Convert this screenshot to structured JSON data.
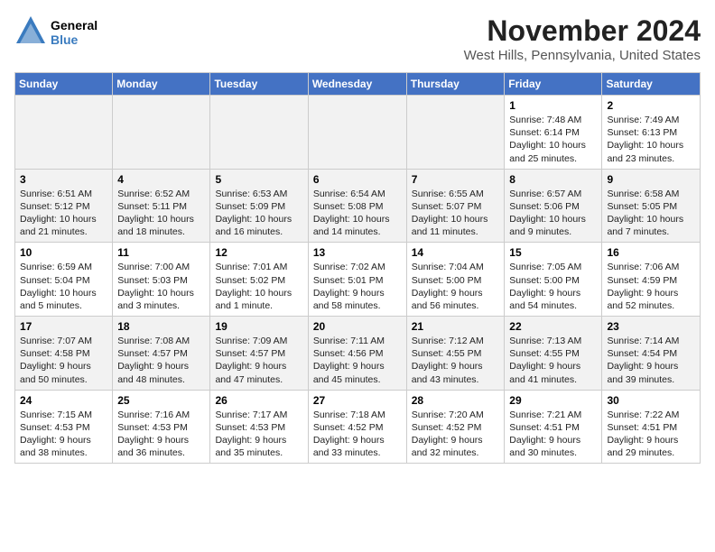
{
  "header": {
    "logo": {
      "line1": "General",
      "line2": "Blue"
    },
    "title": "November 2024",
    "subtitle": "West Hills, Pennsylvania, United States"
  },
  "weekdays": [
    "Sunday",
    "Monday",
    "Tuesday",
    "Wednesday",
    "Thursday",
    "Friday",
    "Saturday"
  ],
  "weeks": [
    [
      {
        "day": "",
        "sunrise": "",
        "sunset": "",
        "daylight": ""
      },
      {
        "day": "",
        "sunrise": "",
        "sunset": "",
        "daylight": ""
      },
      {
        "day": "",
        "sunrise": "",
        "sunset": "",
        "daylight": ""
      },
      {
        "day": "",
        "sunrise": "",
        "sunset": "",
        "daylight": ""
      },
      {
        "day": "",
        "sunrise": "",
        "sunset": "",
        "daylight": ""
      },
      {
        "day": "1",
        "sunrise": "Sunrise: 7:48 AM",
        "sunset": "Sunset: 6:14 PM",
        "daylight": "Daylight: 10 hours and 25 minutes."
      },
      {
        "day": "2",
        "sunrise": "Sunrise: 7:49 AM",
        "sunset": "Sunset: 6:13 PM",
        "daylight": "Daylight: 10 hours and 23 minutes."
      }
    ],
    [
      {
        "day": "3",
        "sunrise": "Sunrise: 6:51 AM",
        "sunset": "Sunset: 5:12 PM",
        "daylight": "Daylight: 10 hours and 21 minutes."
      },
      {
        "day": "4",
        "sunrise": "Sunrise: 6:52 AM",
        "sunset": "Sunset: 5:11 PM",
        "daylight": "Daylight: 10 hours and 18 minutes."
      },
      {
        "day": "5",
        "sunrise": "Sunrise: 6:53 AM",
        "sunset": "Sunset: 5:09 PM",
        "daylight": "Daylight: 10 hours and 16 minutes."
      },
      {
        "day": "6",
        "sunrise": "Sunrise: 6:54 AM",
        "sunset": "Sunset: 5:08 PM",
        "daylight": "Daylight: 10 hours and 14 minutes."
      },
      {
        "day": "7",
        "sunrise": "Sunrise: 6:55 AM",
        "sunset": "Sunset: 5:07 PM",
        "daylight": "Daylight: 10 hours and 11 minutes."
      },
      {
        "day": "8",
        "sunrise": "Sunrise: 6:57 AM",
        "sunset": "Sunset: 5:06 PM",
        "daylight": "Daylight: 10 hours and 9 minutes."
      },
      {
        "day": "9",
        "sunrise": "Sunrise: 6:58 AM",
        "sunset": "Sunset: 5:05 PM",
        "daylight": "Daylight: 10 hours and 7 minutes."
      }
    ],
    [
      {
        "day": "10",
        "sunrise": "Sunrise: 6:59 AM",
        "sunset": "Sunset: 5:04 PM",
        "daylight": "Daylight: 10 hours and 5 minutes."
      },
      {
        "day": "11",
        "sunrise": "Sunrise: 7:00 AM",
        "sunset": "Sunset: 5:03 PM",
        "daylight": "Daylight: 10 hours and 3 minutes."
      },
      {
        "day": "12",
        "sunrise": "Sunrise: 7:01 AM",
        "sunset": "Sunset: 5:02 PM",
        "daylight": "Daylight: 10 hours and 1 minute."
      },
      {
        "day": "13",
        "sunrise": "Sunrise: 7:02 AM",
        "sunset": "Sunset: 5:01 PM",
        "daylight": "Daylight: 9 hours and 58 minutes."
      },
      {
        "day": "14",
        "sunrise": "Sunrise: 7:04 AM",
        "sunset": "Sunset: 5:00 PM",
        "daylight": "Daylight: 9 hours and 56 minutes."
      },
      {
        "day": "15",
        "sunrise": "Sunrise: 7:05 AM",
        "sunset": "Sunset: 5:00 PM",
        "daylight": "Daylight: 9 hours and 54 minutes."
      },
      {
        "day": "16",
        "sunrise": "Sunrise: 7:06 AM",
        "sunset": "Sunset: 4:59 PM",
        "daylight": "Daylight: 9 hours and 52 minutes."
      }
    ],
    [
      {
        "day": "17",
        "sunrise": "Sunrise: 7:07 AM",
        "sunset": "Sunset: 4:58 PM",
        "daylight": "Daylight: 9 hours and 50 minutes."
      },
      {
        "day": "18",
        "sunrise": "Sunrise: 7:08 AM",
        "sunset": "Sunset: 4:57 PM",
        "daylight": "Daylight: 9 hours and 48 minutes."
      },
      {
        "day": "19",
        "sunrise": "Sunrise: 7:09 AM",
        "sunset": "Sunset: 4:57 PM",
        "daylight": "Daylight: 9 hours and 47 minutes."
      },
      {
        "day": "20",
        "sunrise": "Sunrise: 7:11 AM",
        "sunset": "Sunset: 4:56 PM",
        "daylight": "Daylight: 9 hours and 45 minutes."
      },
      {
        "day": "21",
        "sunrise": "Sunrise: 7:12 AM",
        "sunset": "Sunset: 4:55 PM",
        "daylight": "Daylight: 9 hours and 43 minutes."
      },
      {
        "day": "22",
        "sunrise": "Sunrise: 7:13 AM",
        "sunset": "Sunset: 4:55 PM",
        "daylight": "Daylight: 9 hours and 41 minutes."
      },
      {
        "day": "23",
        "sunrise": "Sunrise: 7:14 AM",
        "sunset": "Sunset: 4:54 PM",
        "daylight": "Daylight: 9 hours and 39 minutes."
      }
    ],
    [
      {
        "day": "24",
        "sunrise": "Sunrise: 7:15 AM",
        "sunset": "Sunset: 4:53 PM",
        "daylight": "Daylight: 9 hours and 38 minutes."
      },
      {
        "day": "25",
        "sunrise": "Sunrise: 7:16 AM",
        "sunset": "Sunset: 4:53 PM",
        "daylight": "Daylight: 9 hours and 36 minutes."
      },
      {
        "day": "26",
        "sunrise": "Sunrise: 7:17 AM",
        "sunset": "Sunset: 4:53 PM",
        "daylight": "Daylight: 9 hours and 35 minutes."
      },
      {
        "day": "27",
        "sunrise": "Sunrise: 7:18 AM",
        "sunset": "Sunset: 4:52 PM",
        "daylight": "Daylight: 9 hours and 33 minutes."
      },
      {
        "day": "28",
        "sunrise": "Sunrise: 7:20 AM",
        "sunset": "Sunset: 4:52 PM",
        "daylight": "Daylight: 9 hours and 32 minutes."
      },
      {
        "day": "29",
        "sunrise": "Sunrise: 7:21 AM",
        "sunset": "Sunset: 4:51 PM",
        "daylight": "Daylight: 9 hours and 30 minutes."
      },
      {
        "day": "30",
        "sunrise": "Sunrise: 7:22 AM",
        "sunset": "Sunset: 4:51 PM",
        "daylight": "Daylight: 9 hours and 29 minutes."
      }
    ]
  ]
}
